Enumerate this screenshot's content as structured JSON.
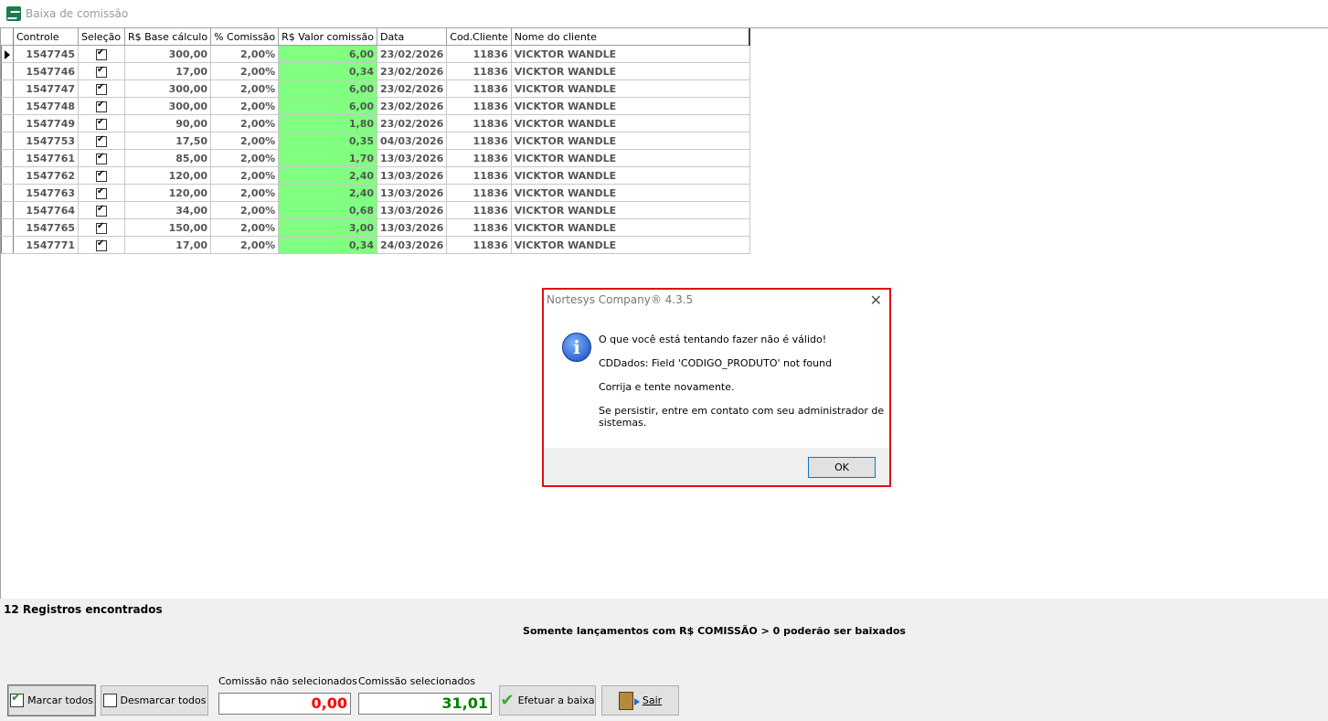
{
  "window": {
    "title": "Baixa de comissão"
  },
  "grid": {
    "headers": [
      "Controle",
      "Seleção",
      "R$ Base cálculo",
      "% Comissão",
      "R$ Valor comissão",
      "Data",
      "Cod.Cliente",
      "Nome do cliente"
    ],
    "rows": [
      {
        "controle": "1547745",
        "selecionado": true,
        "base": "300,00",
        "pct": "2,00%",
        "valor": "6,00",
        "data": "23/02/2026",
        "cod": "11836",
        "nome": "VICKTOR WANDLE"
      },
      {
        "controle": "1547746",
        "selecionado": true,
        "base": "17,00",
        "pct": "2,00%",
        "valor": "0,34",
        "data": "23/02/2026",
        "cod": "11836",
        "nome": "VICKTOR WANDLE"
      },
      {
        "controle": "1547747",
        "selecionado": true,
        "base": "300,00",
        "pct": "2,00%",
        "valor": "6,00",
        "data": "23/02/2026",
        "cod": "11836",
        "nome": "VICKTOR WANDLE"
      },
      {
        "controle": "1547748",
        "selecionado": true,
        "base": "300,00",
        "pct": "2,00%",
        "valor": "6,00",
        "data": "23/02/2026",
        "cod": "11836",
        "nome": "VICKTOR WANDLE"
      },
      {
        "controle": "1547749",
        "selecionado": true,
        "base": "90,00",
        "pct": "2,00%",
        "valor": "1,80",
        "data": "23/02/2026",
        "cod": "11836",
        "nome": "VICKTOR WANDLE"
      },
      {
        "controle": "1547753",
        "selecionado": true,
        "base": "17,50",
        "pct": "2,00%",
        "valor": "0,35",
        "data": "04/03/2026",
        "cod": "11836",
        "nome": "VICKTOR WANDLE"
      },
      {
        "controle": "1547761",
        "selecionado": true,
        "base": "85,00",
        "pct": "2,00%",
        "valor": "1,70",
        "data": "13/03/2026",
        "cod": "11836",
        "nome": "VICKTOR WANDLE"
      },
      {
        "controle": "1547762",
        "selecionado": true,
        "base": "120,00",
        "pct": "2,00%",
        "valor": "2,40",
        "data": "13/03/2026",
        "cod": "11836",
        "nome": "VICKTOR WANDLE"
      },
      {
        "controle": "1547763",
        "selecionado": true,
        "base": "120,00",
        "pct": "2,00%",
        "valor": "2,40",
        "data": "13/03/2026",
        "cod": "11836",
        "nome": "VICKTOR WANDLE"
      },
      {
        "controle": "1547764",
        "selecionado": true,
        "base": "34,00",
        "pct": "2,00%",
        "valor": "0,68",
        "data": "13/03/2026",
        "cod": "11836",
        "nome": "VICKTOR WANDLE"
      },
      {
        "controle": "1547765",
        "selecionado": true,
        "base": "150,00",
        "pct": "2,00%",
        "valor": "3,00",
        "data": "13/03/2026",
        "cod": "11836",
        "nome": "VICKTOR WANDLE"
      },
      {
        "controle": "1547771",
        "selecionado": true,
        "base": "17,00",
        "pct": "2,00%",
        "valor": "0,34",
        "data": "24/03/2026",
        "cod": "11836",
        "nome": "VICKTOR WANDLE"
      }
    ],
    "highlight_color": "#80ff80"
  },
  "footer": {
    "records": "12 Registros encontrados",
    "notice": "Somente lançamentos com R$ COMISSÃO > 0 poderão ser baixados",
    "mark_all": "Marcar todos",
    "unmark_all": "Desmarcar todos",
    "unselected_label": "Comissão não selecionados",
    "unselected_value": "0,00",
    "selected_label": "Comissão selecionados",
    "selected_value": "31,01",
    "execute": "Efetuar a baixa",
    "exit": "Sair",
    "unselected_color": "#ff0000",
    "selected_color": "#008000"
  },
  "dialog": {
    "title": "Nortesys Company® 4.3.5",
    "line1": "O que você está tentando fazer não é válido!",
    "line2": "CDDados: Field 'CODIGO_PRODUTO' not found",
    "line3": "Corrija e tente novamente.",
    "line4a": "Se persistir, entre em contato com seu administrador de",
    "line4b": "sistemas.",
    "ok": "OK",
    "border_color": "#e01010"
  }
}
